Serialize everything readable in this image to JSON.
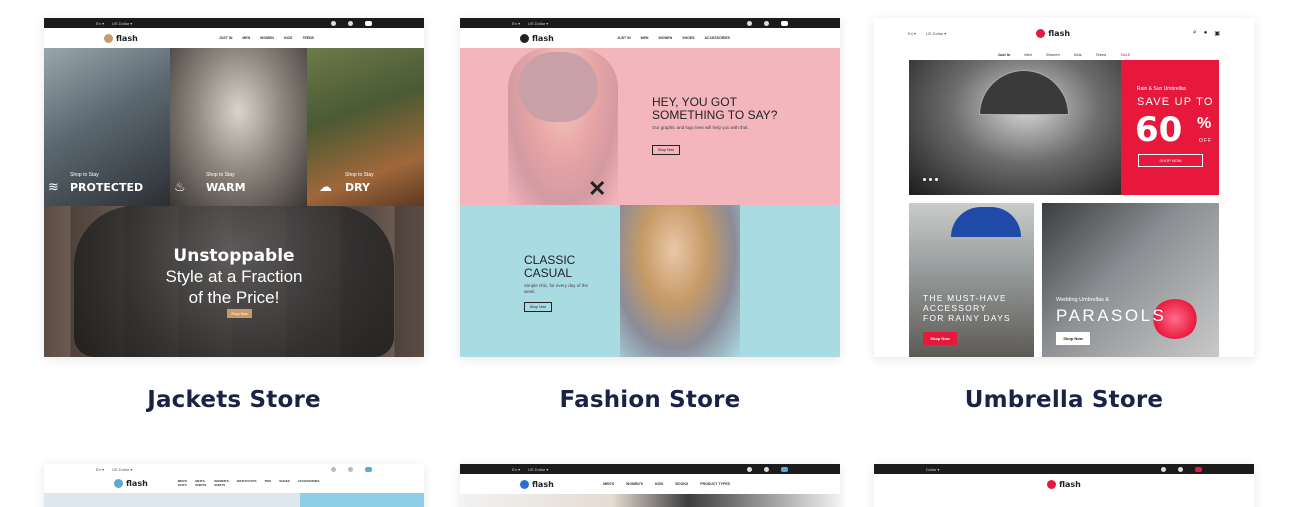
{
  "titles": [
    "Jackets Store",
    "Fashion Store",
    "Umbrella Store"
  ],
  "brand": {
    "name": "flash",
    "accent": "#e8183d",
    "title_color": "#1a2347"
  },
  "jackets": {
    "nav": [
      "JUST IN",
      "MEN",
      "WOMEN",
      "KIDS",
      "TEENS"
    ],
    "panels": [
      {
        "small": "Shop to Stay",
        "big": "PROTECTED",
        "icon": "wind-icon"
      },
      {
        "small": "Shop to Stay",
        "big": "WARM",
        "icon": "flame-icon"
      },
      {
        "small": "Shop to Stay",
        "big": "DRY",
        "icon": "rain-cloud-icon"
      }
    ],
    "headline": "Unstoppable",
    "line2": "Style at a Fraction",
    "line3": "of the Price!",
    "button": "Shop Now"
  },
  "fashion": {
    "nav": [
      "JUST IN",
      "MEN",
      "WOMEN",
      "SHOES",
      "ACCESSORIES"
    ],
    "hero1_line1": "HEY, YOU GOT",
    "hero1_line2": "SOMETHING TO SAY?",
    "hero1_text": "Our graphic and logo tees will help you with that.",
    "hero1_button": "Shop Now",
    "hero2_line1": "CLASSIC",
    "hero2_line2": "CASUAL",
    "hero2_text": "Simple chic, for every day of the week.",
    "hero2_button": "Shop Now"
  },
  "umbrella": {
    "nav": [
      "Just In",
      "Men",
      "Women",
      "Kids",
      "Teens",
      "SALE"
    ],
    "promo_small": "Rain & Sun Umbrellas",
    "promo_save": "SAVE UP TO",
    "promo_value": "60",
    "promo_pct": "%",
    "promo_off": "OFF",
    "promo_button": "SHOP NOW",
    "card1_line1": "THE MUST-HAVE",
    "card1_line2": "ACCESSORY",
    "card1_line3": "FOR RAINY DAYS",
    "card1_button": "Shop Now",
    "card2_small": "Wedding Umbrellas &",
    "card2_big": "PARASOLS",
    "card2_button": "Shop Now"
  },
  "bottom_nav": [
    "MEN'S SUITS",
    "MEN'S SHIRTS",
    "WOMEN'S SHIRTS",
    "WAISTCOATS",
    "TIES",
    "SHOES",
    "ACCESSORIES"
  ],
  "bottom2_nav": [
    "MEN'S",
    "WOMEN'S",
    "KIDS",
    "BOOKS",
    "PRODUCT TYPES"
  ]
}
